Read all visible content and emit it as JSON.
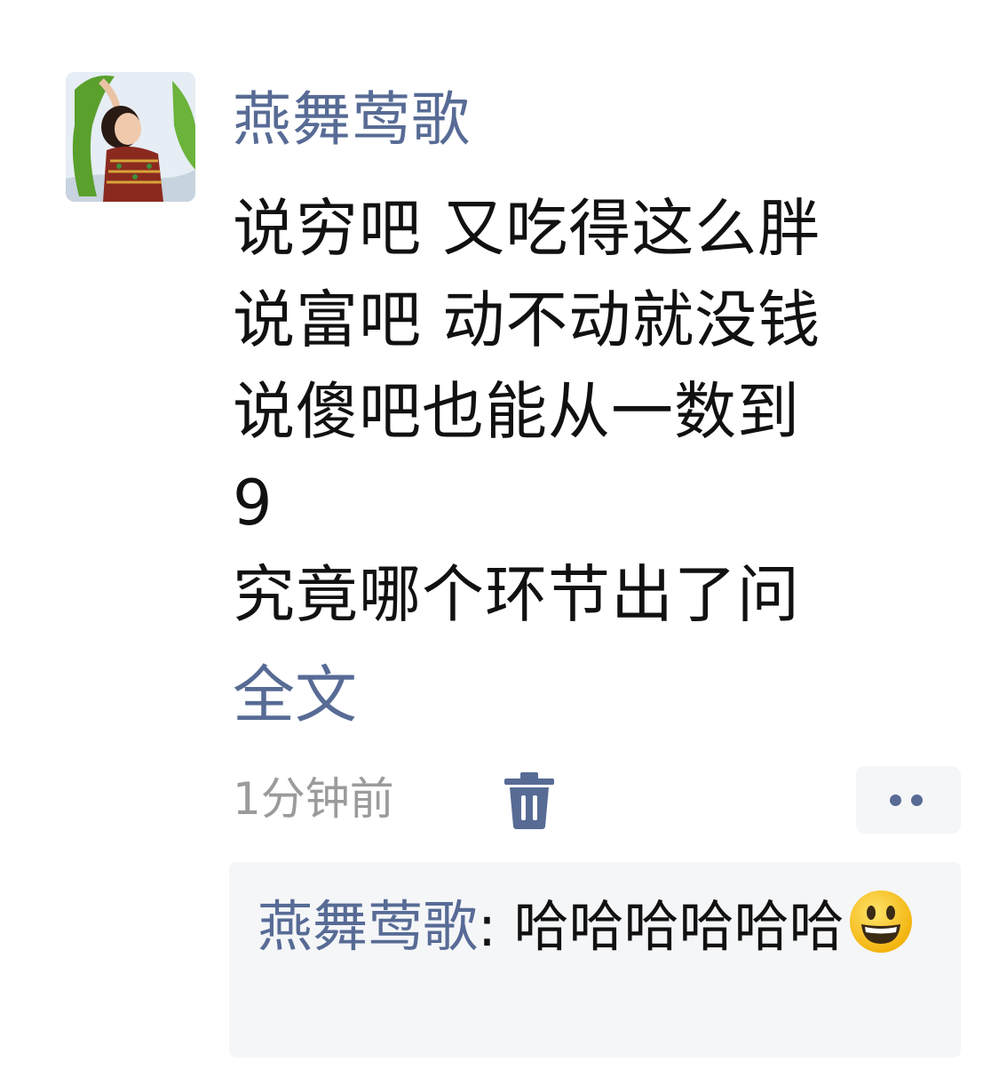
{
  "post": {
    "author": "燕舞莺歌",
    "content_lines": [
      "说穷吧 又吃得这么胖",
      "说富吧 动不动就没钱",
      "说傻吧也能从一数到",
      "9",
      "究竟哪个环节出了问"
    ],
    "full_text_label": "全文",
    "timestamp": "1分钟前",
    "icons": {
      "avatar": "dancer-photo",
      "delete": "trash-icon",
      "more": "more-dots-icon",
      "emoji": "smiley-emoji"
    }
  },
  "comments": [
    {
      "author": "燕舞莺歌",
      "separator": ": ",
      "text": "哈哈哈哈哈哈",
      "emoji": "😃"
    }
  ],
  "colors": {
    "link": "#576b95",
    "text": "#111111",
    "muted": "#9b9b9b",
    "panel": "#f5f6f8"
  }
}
